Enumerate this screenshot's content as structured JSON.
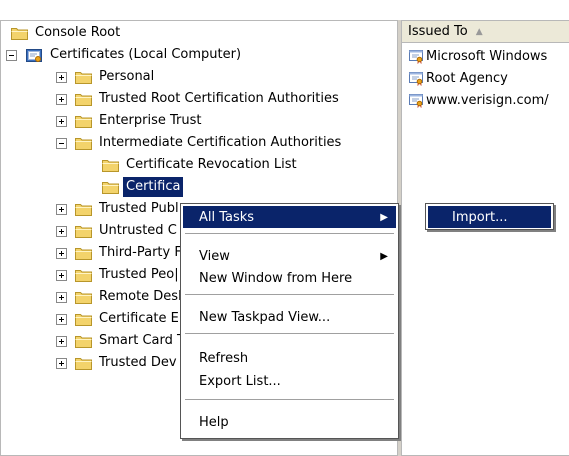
{
  "tree": {
    "root": "Console Root",
    "certificates": "Certificates (Local Computer)",
    "personal": "Personal",
    "trusted_root": "Trusted Root Certification Authorities",
    "enterprise_trust": "Enterprise Trust",
    "intermediate": "Intermediate Certification Authorities",
    "crl": "Certificate Revocation List",
    "certificates_child": "Certifica",
    "trusted_publishers": "Trusted Publ",
    "untrusted": "Untrusted C",
    "third_party": "Third-Party F",
    "trusted_people": "Trusted Peo|",
    "remote_desktop": "Remote Desk",
    "cert_enrollment": "Certificate E",
    "smart_card": "Smart Card T",
    "trusted_devices": "Trusted Dev"
  },
  "list": {
    "column_header": "Issued To",
    "items": [
      "Microsoft Windows",
      "Root Agency",
      "www.verisign.com/"
    ]
  },
  "context_menu": {
    "all_tasks": "All Tasks",
    "view": "View",
    "new_window": "New Window from Here",
    "new_taskpad": "New Taskpad View...",
    "refresh": "Refresh",
    "export_list": "Export List...",
    "help": "Help"
  },
  "submenu": {
    "import": "Import..."
  },
  "colors": {
    "highlight": "#0a246a",
    "folder": "#f3d36b"
  }
}
